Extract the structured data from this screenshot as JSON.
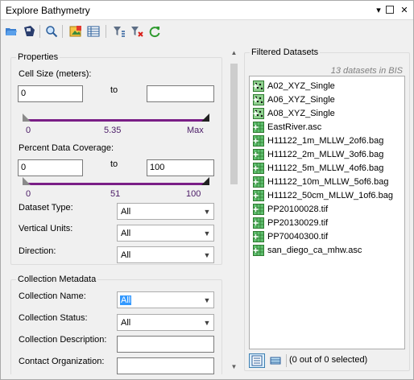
{
  "window": {
    "title": "Explore Bathymetry",
    "dropdown_glyph": "▾",
    "maximize_glyph": "□",
    "close_glyph": "✕"
  },
  "toolbar": {
    "icons": [
      "open-folder-icon",
      "save-icon",
      "search-icon",
      "add-data-icon",
      "table-icon",
      "filter-icon",
      "clear-filter-icon",
      "refresh-icon"
    ]
  },
  "properties": {
    "group_label": "Properties",
    "cell_size_label": "Cell Size (meters):",
    "cell_size_min": "0",
    "to_label": "to",
    "cell_size_max": "",
    "cell_ticks": [
      "0",
      "5.35",
      "Max"
    ],
    "coverage_label": "Percent Data Coverage:",
    "coverage_min": "0",
    "coverage_max": "100",
    "coverage_ticks": [
      "0",
      "51",
      "100"
    ],
    "dataset_type_label": "Dataset Type:",
    "dataset_type_value": "All",
    "vertical_units_label": "Vertical Units:",
    "vertical_units_value": "All",
    "direction_label": "Direction:",
    "direction_value": "All"
  },
  "collection": {
    "group_label": "Collection Metadata",
    "name_label": "Collection Name:",
    "name_value": "All",
    "status_label": "Collection Status:",
    "status_value": "All",
    "description_label": "Collection Description:",
    "description_value": "",
    "contact_label": "Contact Organization:",
    "contact_value": ""
  },
  "filtered": {
    "group_label": "Filtered Datasets",
    "count_text": "13 datasets in BIS",
    "items": [
      {
        "name": "A02_XYZ_Single",
        "icon": "point-dataset-icon"
      },
      {
        "name": "A06_XYZ_Single",
        "icon": "point-dataset-icon"
      },
      {
        "name": "A08_XYZ_Single",
        "icon": "point-dataset-icon"
      },
      {
        "name": "EastRiver.asc",
        "icon": "raster-dataset-icon"
      },
      {
        "name": "H11122_1m_MLLW_2of6.bag",
        "icon": "raster-dataset-icon"
      },
      {
        "name": "H11122_2m_MLLW_3of6.bag",
        "icon": "raster-dataset-icon"
      },
      {
        "name": "H11122_5m_MLLW_4of6.bag",
        "icon": "raster-dataset-icon"
      },
      {
        "name": "H11122_10m_MLLW_5of6.bag",
        "icon": "raster-dataset-icon"
      },
      {
        "name": "H11122_50cm_MLLW_1of6.bag",
        "icon": "raster-dataset-icon"
      },
      {
        "name": "PP20100028.tif",
        "icon": "raster-dataset-icon"
      },
      {
        "name": "PP20130029.tif",
        "icon": "raster-dataset-icon"
      },
      {
        "name": "PP70040300.tif",
        "icon": "raster-dataset-icon"
      },
      {
        "name": "san_diego_ca_mhw.asc",
        "icon": "raster-dataset-icon"
      }
    ],
    "selection_text": "(0 out of 0 selected)"
  }
}
